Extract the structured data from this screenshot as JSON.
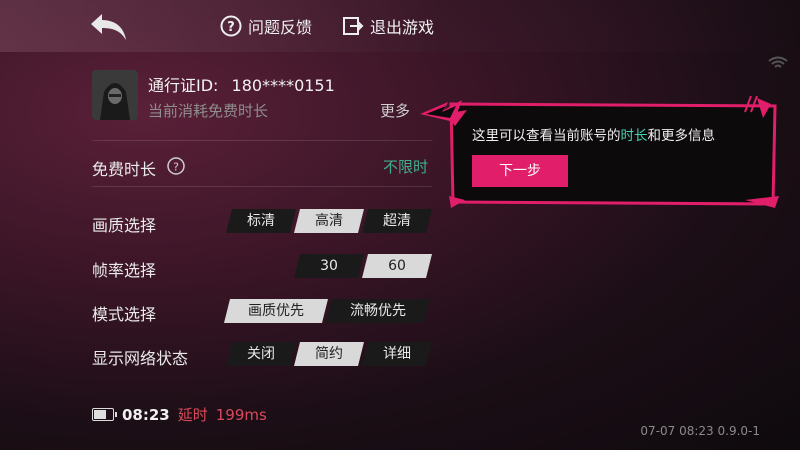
{
  "header": {
    "feedback_label": "问题反馈",
    "exit_label": "退出游戏"
  },
  "account": {
    "id_label": "通行证ID:",
    "id_value": "180****0151",
    "subtitle": "当前消耗免费时长",
    "more_label": "更多"
  },
  "free_time": {
    "label": "免费时长",
    "value": "不限时",
    "value_color": "#3fae8c"
  },
  "settings": {
    "quality": {
      "label": "画质选择",
      "options": [
        "标清",
        "高清",
        "超清"
      ],
      "selected": "高清"
    },
    "fps": {
      "label": "帧率选择",
      "options": [
        "30",
        "60"
      ],
      "selected": "60"
    },
    "mode": {
      "label": "模式选择",
      "options": [
        "画质优先",
        "流畅优先"
      ],
      "selected": "画质优先"
    },
    "network": {
      "label": "显示网络状态",
      "options": [
        "关闭",
        "简约",
        "详细"
      ],
      "selected": "简约"
    }
  },
  "status": {
    "time": "08:23",
    "latency_label": "延时",
    "latency_value": "199ms"
  },
  "version": "07-07 08:23 0.9.0-1",
  "tooltip": {
    "text_before": "这里可以查看当前账号的",
    "text_highlight": "时长",
    "text_after": "和更多信息",
    "next_label": "下一步",
    "accent_color": "#e01e69",
    "highlight_color": "#46d0b0"
  }
}
